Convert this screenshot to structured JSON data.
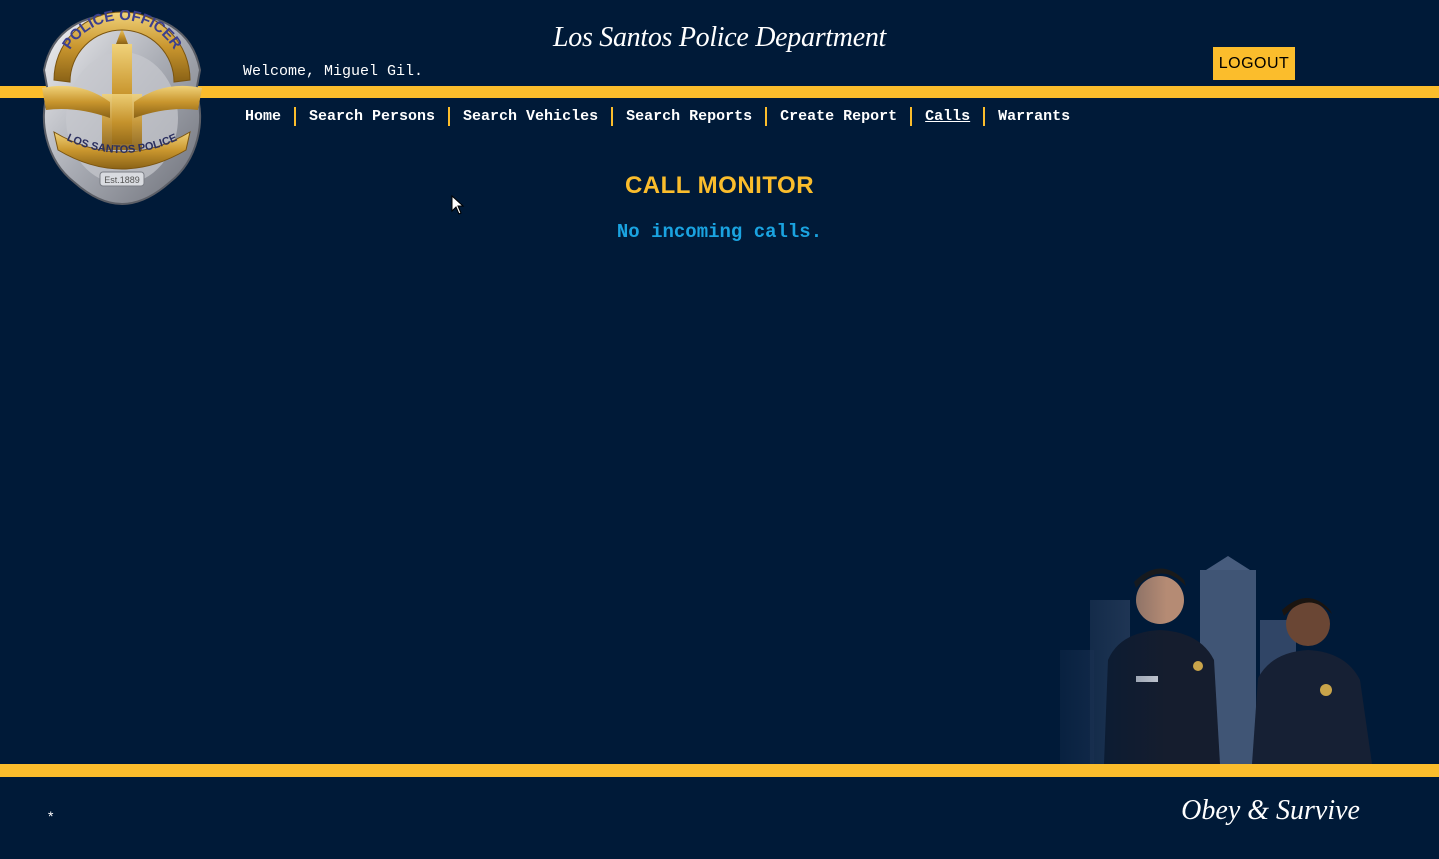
{
  "header": {
    "title": "Los Santos Police Department",
    "welcome": "Welcome, Miguel Gil.",
    "logout_label": "LOGOUT"
  },
  "badge": {
    "top_text": "POLICE OFFICER",
    "ribbon_text": "LOS SANTOS POLICE",
    "est_text": "Est.1889"
  },
  "nav": {
    "items": [
      {
        "label": "Home"
      },
      {
        "label": "Search Persons"
      },
      {
        "label": "Search Vehicles"
      },
      {
        "label": "Search Reports"
      },
      {
        "label": "Create Report"
      },
      {
        "label": "Calls",
        "active": true
      },
      {
        "label": "Warrants"
      }
    ]
  },
  "main": {
    "section_title": "CALL MONITOR",
    "empty_message": "No incoming calls."
  },
  "footer": {
    "mark": "*",
    "motto": "Obey & Survive"
  },
  "colors": {
    "background": "#001a38",
    "accent": "#fbbd2c",
    "message": "#1aa3e0"
  },
  "icons": [
    "police-badge-icon",
    "mouse-cursor-icon"
  ]
}
